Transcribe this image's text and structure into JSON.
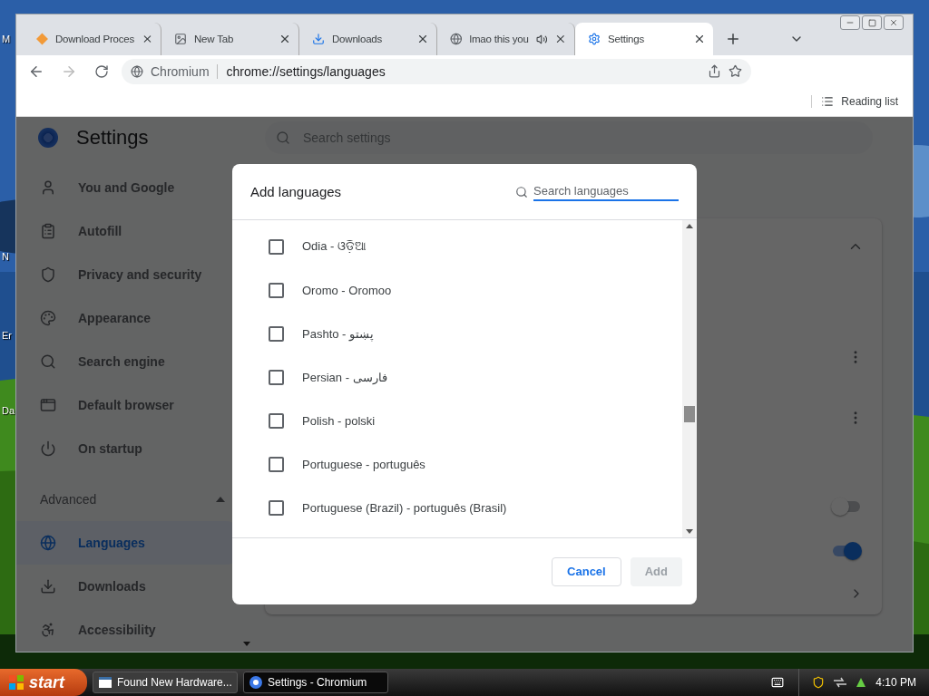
{
  "desktop": {
    "icon_labels": [
      "M",
      "N",
      "Er",
      "Da"
    ]
  },
  "browser": {
    "tabs": [
      {
        "title": "Download Proces",
        "selected": false,
        "audio": false
      },
      {
        "title": "New Tab",
        "selected": false,
        "audio": false
      },
      {
        "title": "Downloads",
        "selected": false,
        "audio": false
      },
      {
        "title": "lmao this you",
        "selected": false,
        "audio": true
      },
      {
        "title": "Settings",
        "selected": true,
        "audio": false
      }
    ],
    "omnibox": {
      "site": "Chromium",
      "url": "chrome://settings/languages"
    },
    "reading_list": "Reading list"
  },
  "settings": {
    "title": "Settings",
    "search_placeholder": "Search settings",
    "nav": [
      {
        "label": "You and Google",
        "selected": false
      },
      {
        "label": "Autofill",
        "selected": false
      },
      {
        "label": "Privacy and security",
        "selected": false
      },
      {
        "label": "Appearance",
        "selected": false
      },
      {
        "label": "Search engine",
        "selected": false
      },
      {
        "label": "Default browser",
        "selected": false
      },
      {
        "label": "On startup",
        "selected": false
      }
    ],
    "advanced": {
      "label": "Advanced",
      "expanded": true,
      "items": [
        {
          "label": "Languages",
          "selected": true
        },
        {
          "label": "Downloads",
          "selected": false
        },
        {
          "label": "Accessibility",
          "selected": false
        }
      ]
    },
    "card": {
      "expanded": true,
      "toggles": [
        {
          "on": false
        },
        {
          "on": true
        }
      ]
    }
  },
  "dialog": {
    "title": "Add languages",
    "search_placeholder": "Search languages",
    "languages": [
      {
        "label": "Odia - ଓଡ଼ିଆ",
        "checked": false
      },
      {
        "label": "Oromo - Oromoo",
        "checked": false
      },
      {
        "label": "Pashto - پښتو",
        "checked": false
      },
      {
        "label": "Persian - فارسی",
        "checked": false
      },
      {
        "label": "Polish - polski",
        "checked": false
      },
      {
        "label": "Portuguese - português",
        "checked": false
      },
      {
        "label": "Portuguese (Brazil) - português (Brasil)",
        "checked": false
      }
    ],
    "buttons": [
      {
        "label": "Cancel",
        "disabled": false
      },
      {
        "label": "Add",
        "disabled": true
      }
    ]
  },
  "taskbar": {
    "start": "start",
    "tasks": [
      {
        "title": "Found New Hardware...",
        "selected": false
      },
      {
        "title": "Settings - Chromium",
        "selected": true
      }
    ],
    "clock": "4:10 PM"
  }
}
